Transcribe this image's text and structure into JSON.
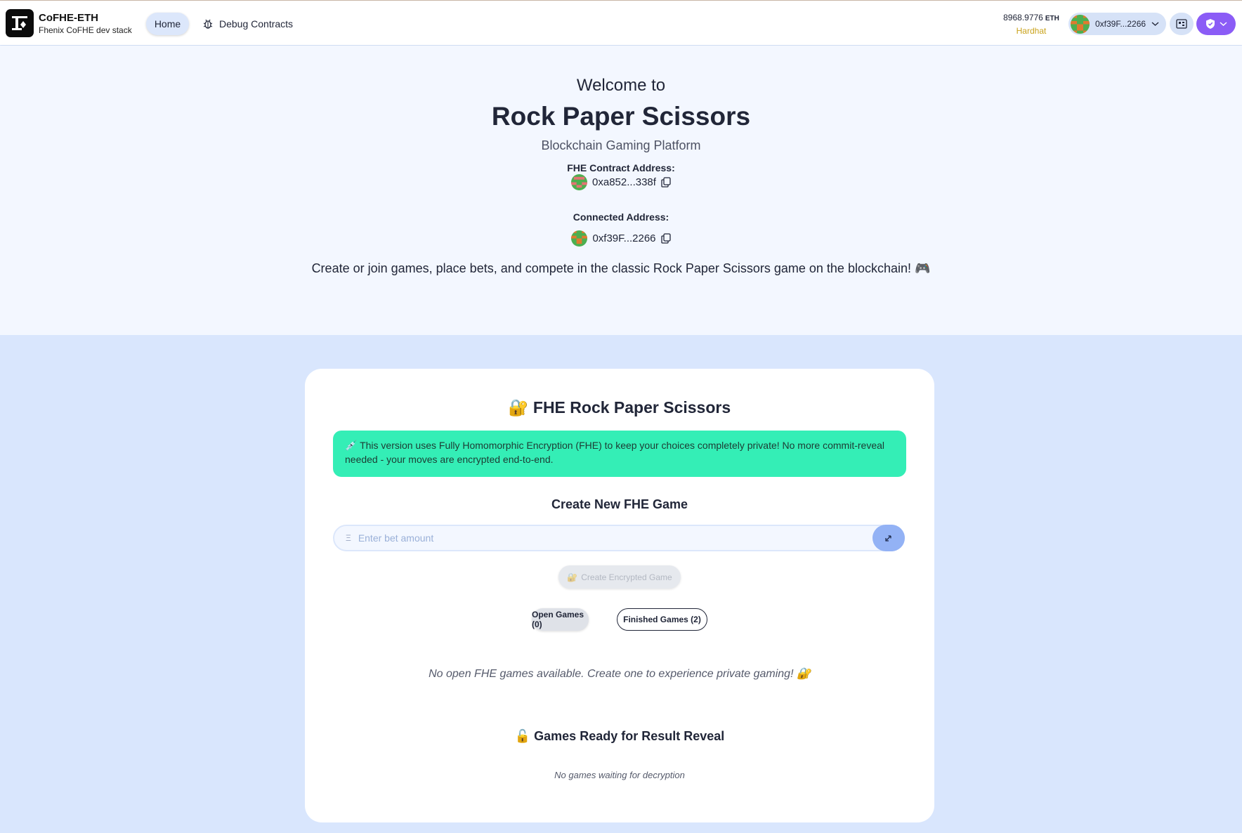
{
  "header": {
    "brand_title": "CoFHE-ETH",
    "brand_subtitle": "Fhenix CoFHE dev stack",
    "nav": [
      {
        "label": "Home",
        "active": true
      },
      {
        "label": "Debug Contracts",
        "icon": "bug-icon"
      }
    ],
    "balance_value": "8968.9776",
    "balance_unit": "ETH",
    "network": "Hardhat",
    "account_label": "0xf39F...2266",
    "colors": {
      "accent": "#8b5cf6",
      "network": "#c9a21a"
    }
  },
  "hero": {
    "welcome": "Welcome to",
    "title": "Rock Paper Scissors",
    "subtitle": "Blockchain Gaming Platform",
    "contract_label": "FHE Contract Address:",
    "contract_address": "0xa852...338f",
    "connected_label": "Connected Address:",
    "connected_address": "0xf39F...2266",
    "description": "Create or join games, place bets, and compete in the classic Rock Paper Scissors game on the blockchain! 🎮"
  },
  "game": {
    "title_icon": "🔐",
    "title": "FHE Rock Paper Scissors",
    "info_icon": "💉",
    "info_text": "This version uses Fully Homomorphic Encryption (FHE) to keep your choices completely private! No more commit-reveal needed - your moves are encrypted end-to-end.",
    "create_title": "Create New FHE Game",
    "bet_symbol": "Ξ",
    "bet_placeholder": "Enter bet amount",
    "bet_value": "",
    "create_button_icon": "🔐",
    "create_button": "Create Encrypted Game",
    "tabs": [
      {
        "label": "Open Games (0)",
        "active": true
      },
      {
        "label": "Finished Games (2)",
        "active": false
      }
    ],
    "empty_open": "No open FHE games available. Create one to experience private gaming! 🔐",
    "reveal_icon": "🔓",
    "reveal_title": "Games Ready for Result Reveal",
    "reveal_empty": "No games waiting for decryption"
  }
}
